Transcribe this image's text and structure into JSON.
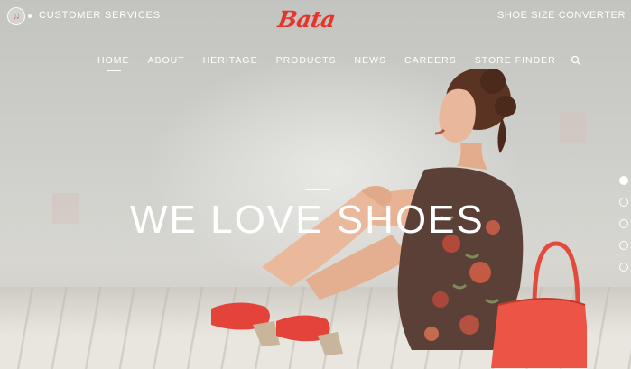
{
  "header": {
    "customer_services_label": "CUSTOMER SERVICES",
    "customer_services_icon": "customer-services-icon",
    "logo_text": "Bata",
    "shoe_size_converter_label": "SHOE SIZE CONVERTER"
  },
  "nav": {
    "items": [
      {
        "label": "HOME",
        "active": true
      },
      {
        "label": "ABOUT",
        "active": false
      },
      {
        "label": "HERITAGE",
        "active": false
      },
      {
        "label": "PRODUCTS",
        "active": false
      },
      {
        "label": "NEWS",
        "active": false
      },
      {
        "label": "CAREERS",
        "active": false
      },
      {
        "label": "STORE FINDER",
        "active": false
      }
    ],
    "search_icon": "search-icon"
  },
  "hero": {
    "headline": "WE LOVE SHOES",
    "slide_count": 5,
    "active_slide": 1
  },
  "colors": {
    "brand_red": "#e5352c",
    "text_white": "#ffffff",
    "background": "#c9c8c3"
  }
}
